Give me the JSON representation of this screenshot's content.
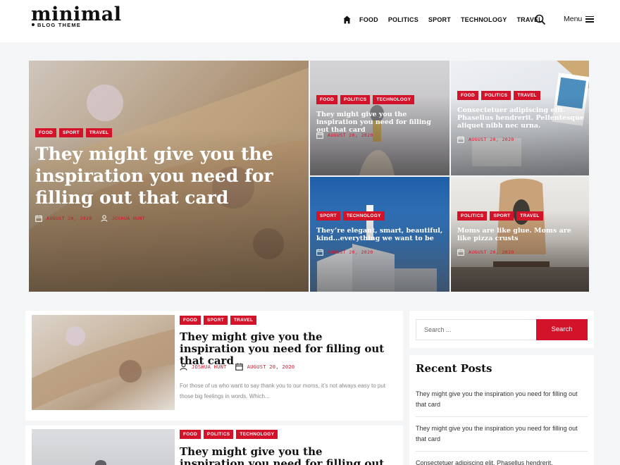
{
  "logo": {
    "main": "minimal",
    "tagline": "BLOG THEME"
  },
  "nav": {
    "items": [
      "FOOD",
      "POLITICS",
      "SPORT",
      "TECHNOLOGY",
      "TRAVEL"
    ],
    "menu_label": "Menu"
  },
  "hero": {
    "main": {
      "categories": [
        "FOOD",
        "SPORT",
        "TRAVEL"
      ],
      "title": "They might give you the inspiration you need for filling out that card",
      "date": "AUGUST 20, 2020",
      "author": "JOSHUA HUNT"
    },
    "tiles": [
      {
        "categories": [
          "FOOD",
          "POLITICS",
          "TECHNOLOGY"
        ],
        "title": "They might give you the inspiration you need for filling out that card",
        "date": "AUGUST 20, 2020"
      },
      {
        "categories": [
          "FOOD",
          "POLITICS",
          "TRAVEL"
        ],
        "title": "Consectetuer adipiscing elit. Phasellus hendrerit. Pellentesque aliquet nibh nec urna.",
        "date": "AUGUST 20, 2020"
      },
      {
        "categories": [
          "SPORT",
          "TECHNOLOGY"
        ],
        "title": "They’re elegant, smart, beautiful, kind...everything we want to be",
        "date": "AUGUST 20, 2020"
      },
      {
        "categories": [
          "POLITICS",
          "SPORT",
          "TRAVEL"
        ],
        "title": "Moms are like glue. Moms are like pizza crusts",
        "date": "AUGUST 20, 2020"
      }
    ]
  },
  "posts": [
    {
      "categories": [
        "FOOD",
        "SPORT",
        "TRAVEL"
      ],
      "title": "They might give you the inspiration you need for filling out that card",
      "author": "JOSHUA HUNT",
      "date": "AUGUST 20, 2020",
      "excerpt": "For those of us who want to say thank you to our moms, it’s not always easy to put those big feelings in words. Which..."
    },
    {
      "categories": [
        "FOOD",
        "POLITICS",
        "TECHNOLOGY"
      ],
      "title": "They might give you the inspiration you need for filling out that card"
    }
  ],
  "sidebar": {
    "search_placeholder": "Search ...",
    "search_button": "Search",
    "recent_title": "Recent Posts",
    "recent": [
      "They might give you the inspiration you need for filling out that card",
      "They might give you the inspiration you need for filling out that card",
      "Consectetuer adipiscing elit. Phasellus hendrerit."
    ]
  },
  "colors": {
    "accent": "#d3132a",
    "background": "#f4f5f7"
  }
}
